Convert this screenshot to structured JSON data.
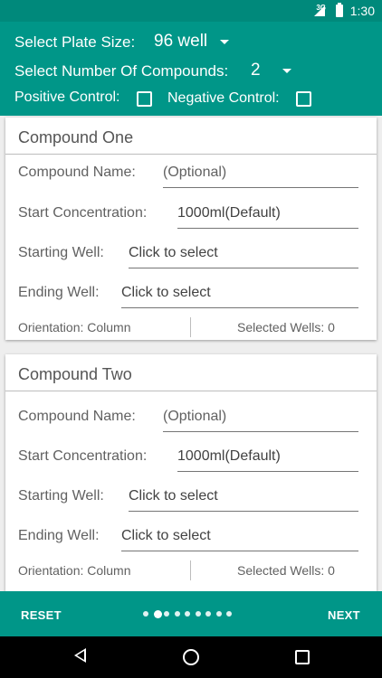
{
  "status_bar": {
    "network": "3G",
    "time": "1:30"
  },
  "header": {
    "plate_size_label": "Select Plate Size:",
    "plate_size_value": "96 well",
    "compounds_label": "Select Number Of Compounds:",
    "compounds_value": "2",
    "positive_control_label": "Positive Control:",
    "negative_control_label": "Negative Control:"
  },
  "cards": [
    {
      "title": "Compound One",
      "compound_name_label": "Compound Name:",
      "compound_name_placeholder": "(Optional)",
      "start_conc_label": "Start Concentration:",
      "start_conc_value": "1000ml(Default)",
      "starting_well_label": "Starting Well:",
      "starting_well_value": "Click to select",
      "ending_well_label": "Ending Well:",
      "ending_well_value": "Click to select",
      "orientation": "Orientation: Column",
      "selected_wells": "Selected Wells: 0"
    },
    {
      "title": "Compound Two",
      "compound_name_label": "Compound Name:",
      "compound_name_placeholder": "(Optional)",
      "start_conc_label": "Start Concentration:",
      "start_conc_value": "1000ml(Default)",
      "starting_well_label": "Starting Well:",
      "starting_well_value": "Click to select",
      "ending_well_label": "Ending Well:",
      "ending_well_value": "Click to select",
      "orientation": "Orientation: Column",
      "selected_wells": "Selected Wells: 0"
    }
  ],
  "bottom_bar": {
    "reset_label": "RESET",
    "next_label": "NEXT",
    "page_count": 9,
    "active_page": 2
  },
  "colors": {
    "primary": "#009688",
    "status_bar": "#00897b"
  }
}
